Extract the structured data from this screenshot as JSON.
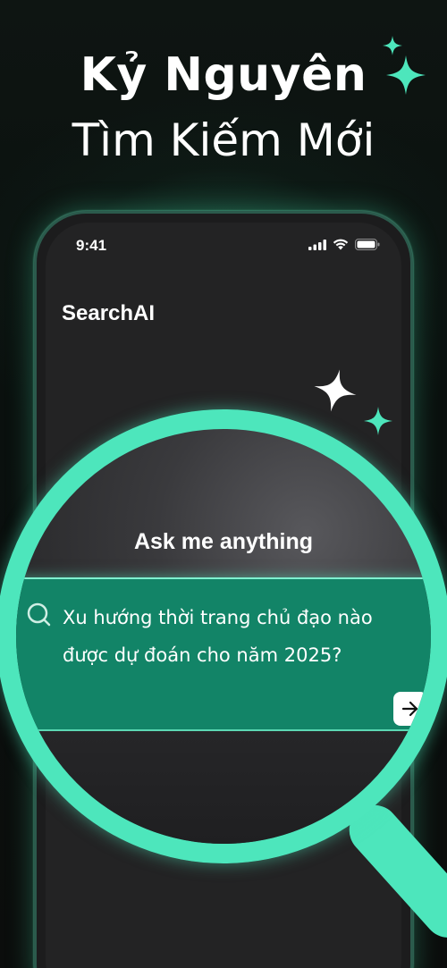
{
  "headline": {
    "line1": "Kỷ Nguyên",
    "line2": "Tìm Kiếm Mới"
  },
  "status_bar": {
    "time": "9:41"
  },
  "app": {
    "title": "SearchAI"
  },
  "search": {
    "prompt_title": "Ask me anything",
    "query_text": "Xu hướng thời trang chủ đạo nào được dự đoán cho năm 2025?"
  },
  "icons": {
    "sparkles": "sparkle-icon",
    "search": "search-icon",
    "send": "arrow-right-icon",
    "signal": "signal-icon",
    "wifi": "wifi-icon",
    "battery": "battery-icon"
  },
  "colors": {
    "accent_mint": "#4de6bc",
    "query_band": "#128467",
    "background": "#0b0e0d"
  }
}
